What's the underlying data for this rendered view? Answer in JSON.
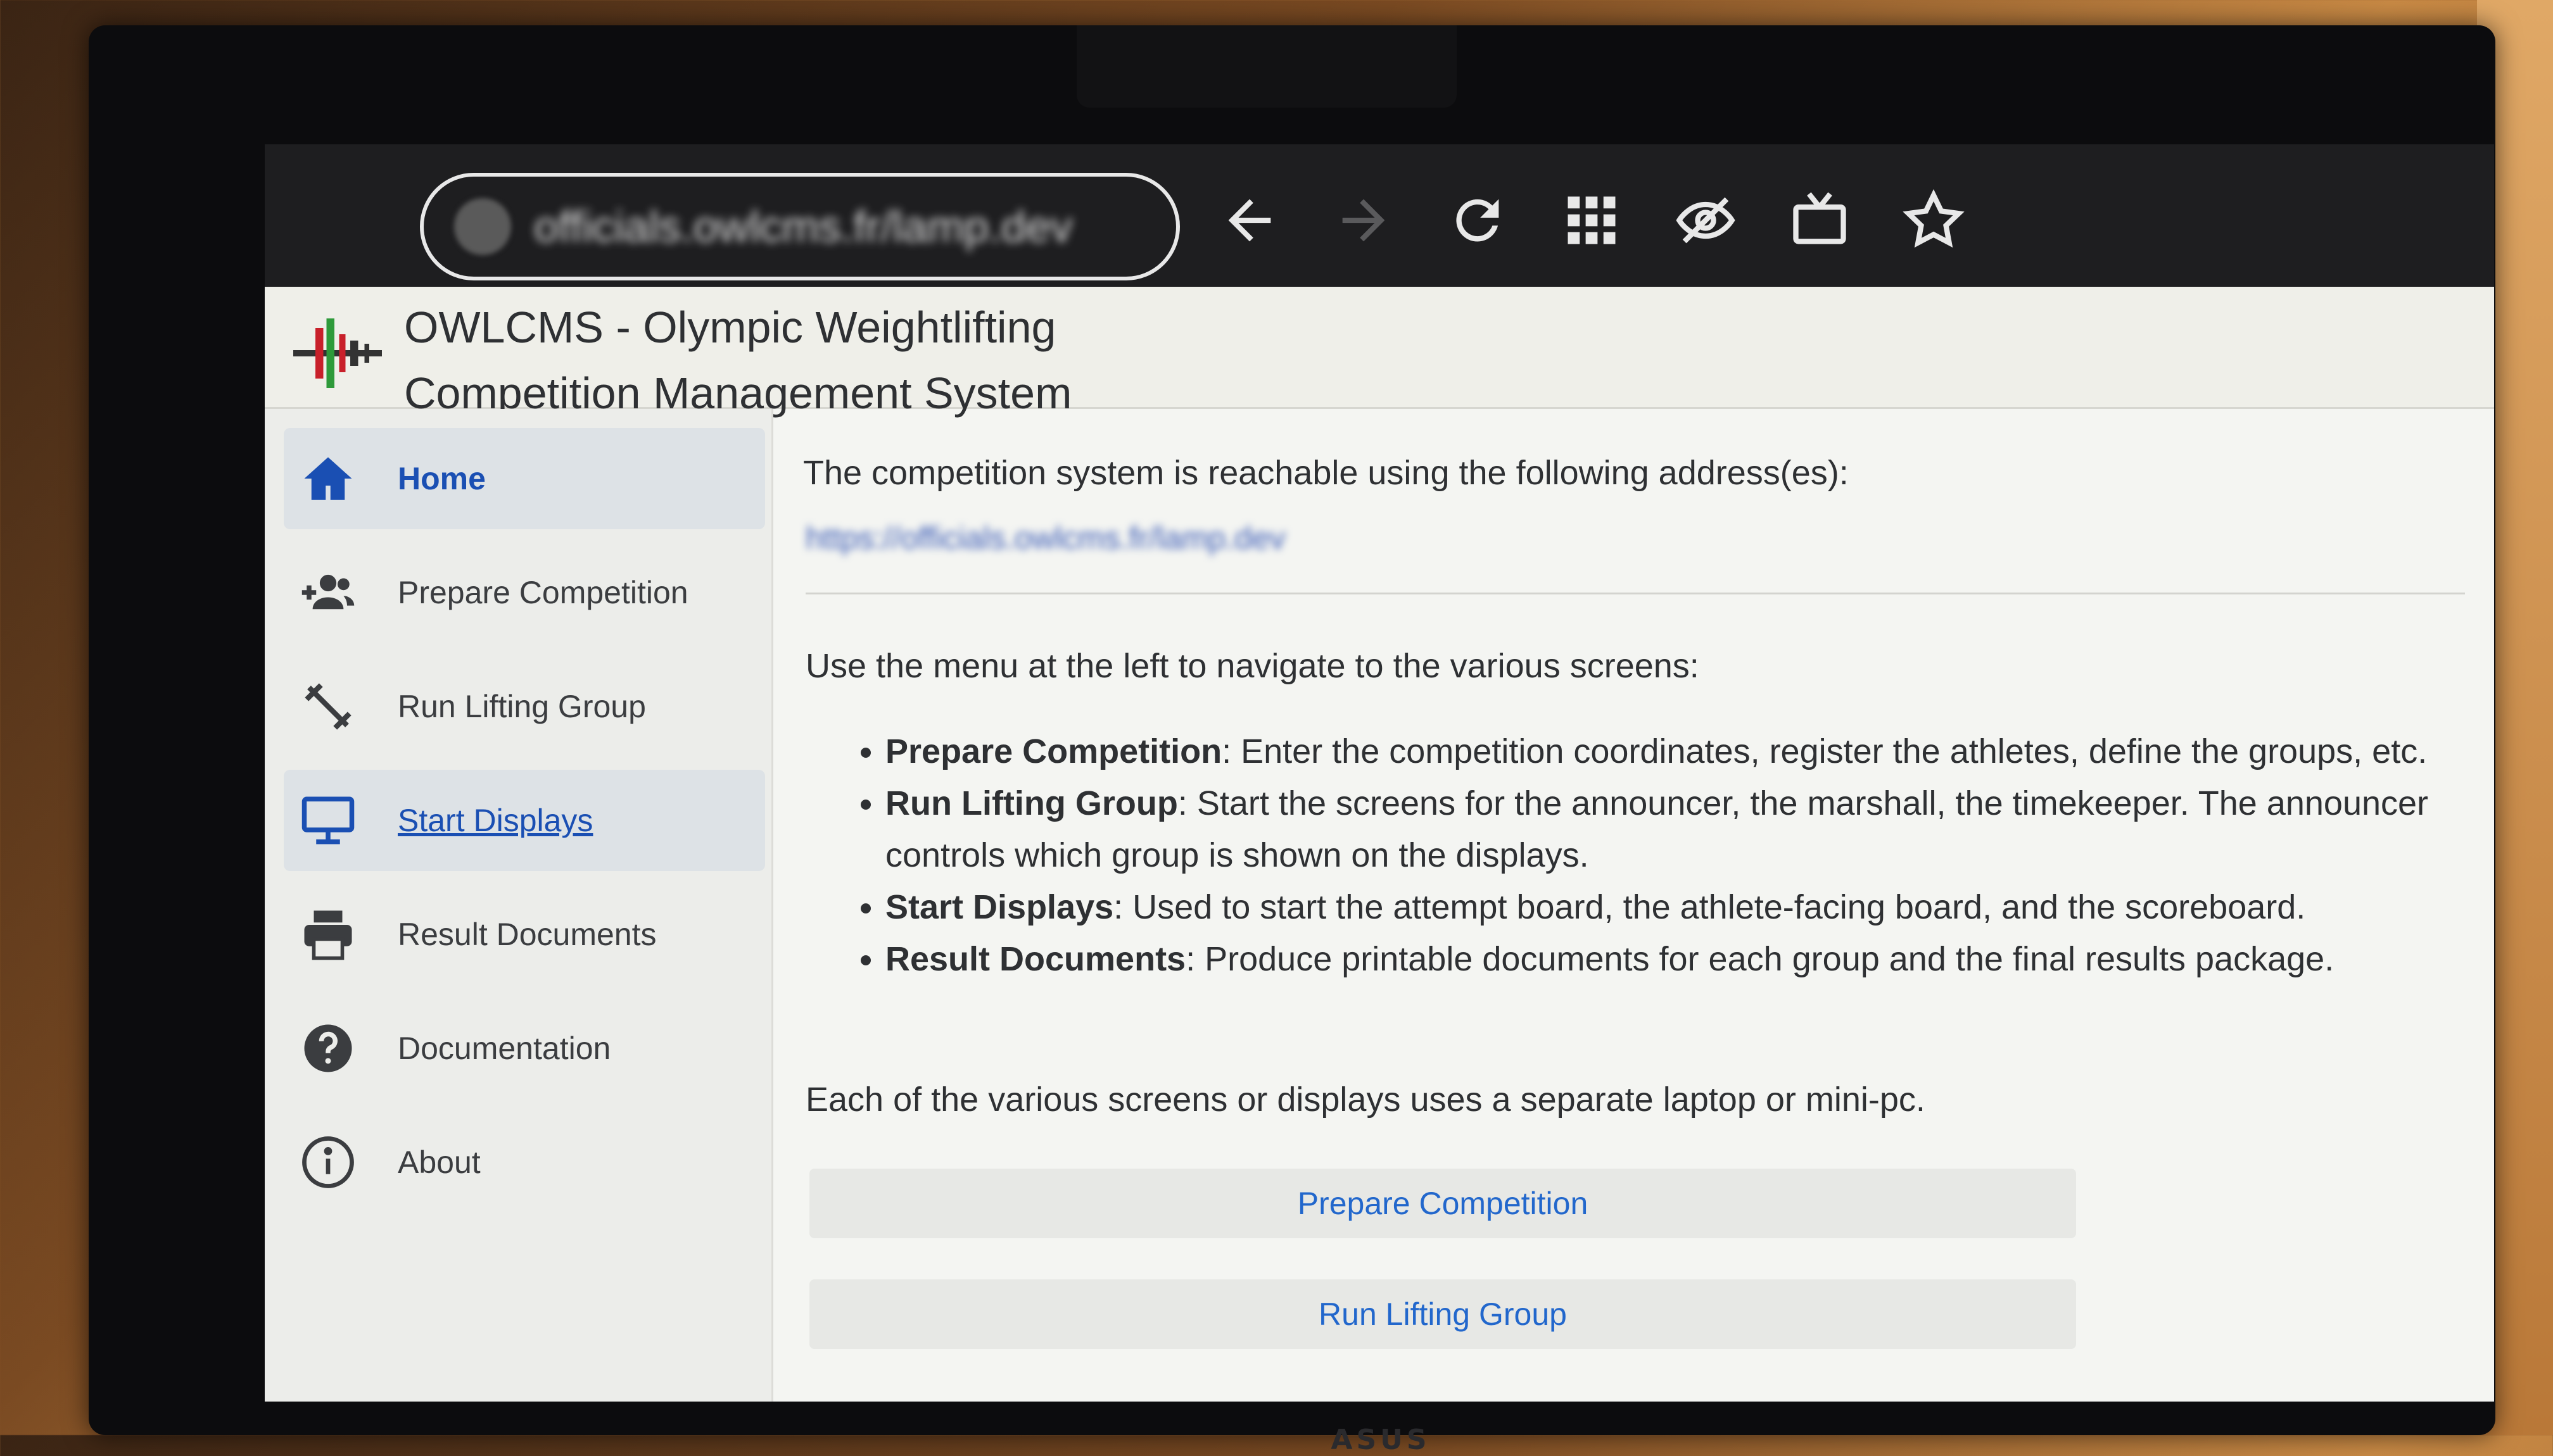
{
  "browser": {
    "url": "officials.owlcms.fr/lamp.dev",
    "icons": [
      "back-arrow-icon",
      "forward-arrow-icon",
      "reload-icon",
      "apps-grid-icon",
      "hide-eye-icon",
      "cast-tv-icon",
      "bookmark-star-icon"
    ]
  },
  "header": {
    "title_line1": "OWLCMS - Olympic Weightlifting",
    "title_line2": "Competition Management System"
  },
  "sidebar": {
    "items": [
      {
        "label": "Home",
        "icon": "home-icon"
      },
      {
        "label": "Prepare Competition",
        "icon": "add-people-icon"
      },
      {
        "label": "Run Lifting Group",
        "icon": "barbell-icon"
      },
      {
        "label": "Start Displays",
        "icon": "monitor-icon"
      },
      {
        "label": "Result Documents",
        "icon": "printer-icon"
      },
      {
        "label": "Documentation",
        "icon": "help-icon"
      },
      {
        "label": "About",
        "icon": "info-icon"
      }
    ]
  },
  "main": {
    "reach_text": "The competition system is reachable using the following address(es):",
    "address": "https://officials.owlcms.fr/lamp.dev",
    "menu_text": "Use the menu at the left to navigate to the various screens:",
    "bullets": [
      {
        "term": "Prepare Competition",
        "desc": ": Enter the competition coordinates, register the athletes, define the groups, etc."
      },
      {
        "term": "Run Lifting Group",
        "desc": ": Start the screens for the announcer, the marshall, the timekeeper. The announcer controls which group is shown on the displays."
      },
      {
        "term": "Start Displays",
        "desc": ": Used to start the attempt board, the athlete-facing board, and the scoreboard."
      },
      {
        "term": "Result Documents",
        "desc": ": Produce printable documents for each group and the final results package."
      }
    ],
    "screens_text": "Each of the various screens or displays uses a separate laptop or mini-pc.",
    "buttons": [
      "Prepare Competition",
      "Run Lifting Group"
    ]
  },
  "monitor": {
    "brand": "ASUS"
  },
  "colors": {
    "link": "#2267cc",
    "selected_bg": "#dde2e6",
    "toolbar": "#1e1e20"
  }
}
